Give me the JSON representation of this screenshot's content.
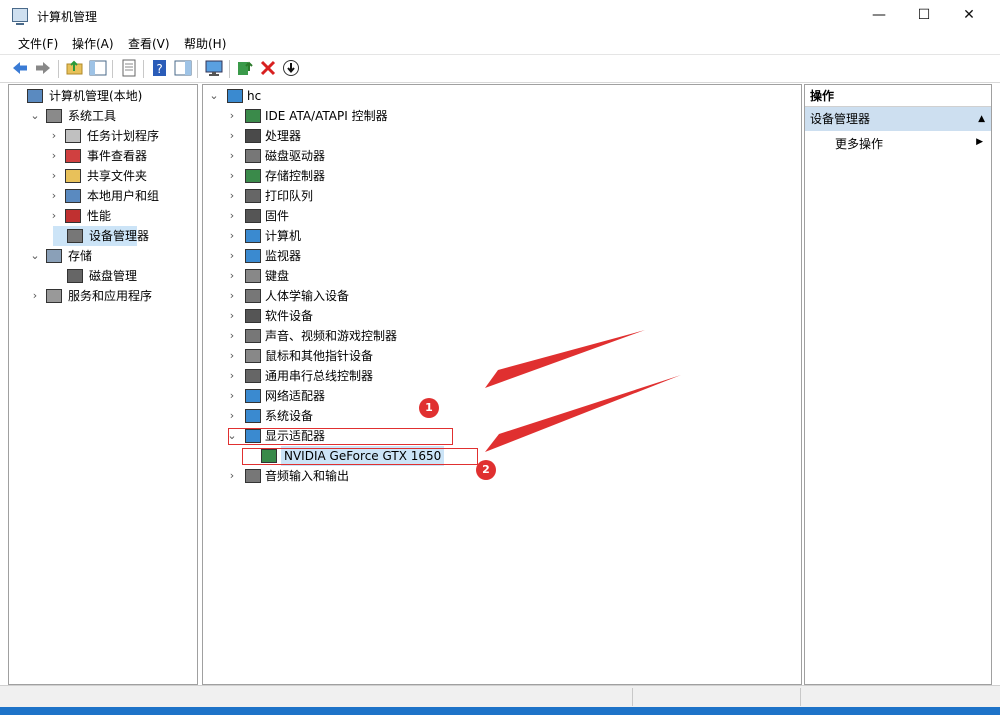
{
  "window": {
    "title": "计算机管理"
  },
  "window_controls": {
    "minimize": "—",
    "maximize": "☐",
    "close": "✕"
  },
  "menu": [
    "文件(F)",
    "操作(A)",
    "查看(V)",
    "帮助(H)"
  ],
  "toolbar": {
    "buttons": [
      "back-icon",
      "forward-icon",
      "up-folder-icon",
      "show-hide-tree-icon",
      "properties-icon",
      "help-icon",
      "show-hide-action-pane-icon",
      "monitor-icon",
      "update-driver-icon",
      "uninstall-icon",
      "disable-icon"
    ],
    "accent_red": "#e03030"
  },
  "left_tree": [
    {
      "label": "计算机管理(本地)",
      "expander": "",
      "icon": "computer-management-icon"
    },
    {
      "label": "系统工具",
      "expander": "⌄",
      "icon": "system-tools-icon"
    },
    {
      "label": "任务计划程序",
      "expander": "›",
      "icon": "task-scheduler-icon"
    },
    {
      "label": "事件查看器",
      "expander": "›",
      "icon": "event-viewer-icon"
    },
    {
      "label": "共享文件夹",
      "expander": "›",
      "icon": "shared-folders-icon"
    },
    {
      "label": "本地用户和组",
      "expander": "›",
      "icon": "users-groups-icon"
    },
    {
      "label": "性能",
      "expander": "›",
      "icon": "performance-icon"
    },
    {
      "label": "设备管理器",
      "expander": "",
      "icon": "device-manager-icon",
      "selected": true
    },
    {
      "label": "存储",
      "expander": "⌄",
      "icon": "storage-icon"
    },
    {
      "label": "磁盘管理",
      "expander": "",
      "icon": "disk-management-icon"
    },
    {
      "label": "服务和应用程序",
      "expander": "›",
      "icon": "services-apps-icon"
    }
  ],
  "device_tree": {
    "root": "hc",
    "root_expander": "⌄",
    "categories": [
      {
        "label": "IDE ATA/ATAPI 控制器",
        "icon": "ide-controller-icon",
        "expander": "›"
      },
      {
        "label": "处理器",
        "icon": "processor-icon",
        "expander": "›"
      },
      {
        "label": "磁盘驱动器",
        "icon": "disk-drive-icon",
        "expander": "›"
      },
      {
        "label": "存储控制器",
        "icon": "storage-controller-icon",
        "expander": "›"
      },
      {
        "label": "打印队列",
        "icon": "print-queue-icon",
        "expander": "›"
      },
      {
        "label": "固件",
        "icon": "firmware-icon",
        "expander": "›"
      },
      {
        "label": "计算机",
        "icon": "computer-icon",
        "expander": "›"
      },
      {
        "label": "监视器",
        "icon": "monitor-icon",
        "expander": "›"
      },
      {
        "label": "键盘",
        "icon": "keyboard-icon",
        "expander": "›"
      },
      {
        "label": "人体学输入设备",
        "icon": "hid-icon",
        "expander": "›"
      },
      {
        "label": "软件设备",
        "icon": "software-device-icon",
        "expander": "›"
      },
      {
        "label": "声音、视频和游戏控制器",
        "icon": "sound-icon",
        "expander": "›"
      },
      {
        "label": "鼠标和其他指针设备",
        "icon": "mouse-icon",
        "expander": "›"
      },
      {
        "label": "通用串行总线控制器",
        "icon": "usb-icon",
        "expander": "›"
      },
      {
        "label": "网络适配器",
        "icon": "network-adapter-icon",
        "expander": "›"
      },
      {
        "label": "系统设备",
        "icon": "system-device-icon",
        "expander": "›"
      },
      {
        "label": "显示适配器",
        "icon": "display-adapter-icon",
        "expander": "⌄"
      },
      {
        "label": "NVIDIA GeForce GTX 1650",
        "icon": "gpu-icon",
        "expander": "",
        "child": true,
        "selected": true
      },
      {
        "label": "音频输入和输出",
        "icon": "audio-io-icon",
        "expander": "›"
      }
    ]
  },
  "actions": {
    "header": "操作",
    "section": "设备管理器",
    "section_arrow": "▲",
    "more": "更多操作",
    "more_arrow": "▶"
  },
  "annotations": {
    "badge1": "1",
    "badge2": "2"
  }
}
